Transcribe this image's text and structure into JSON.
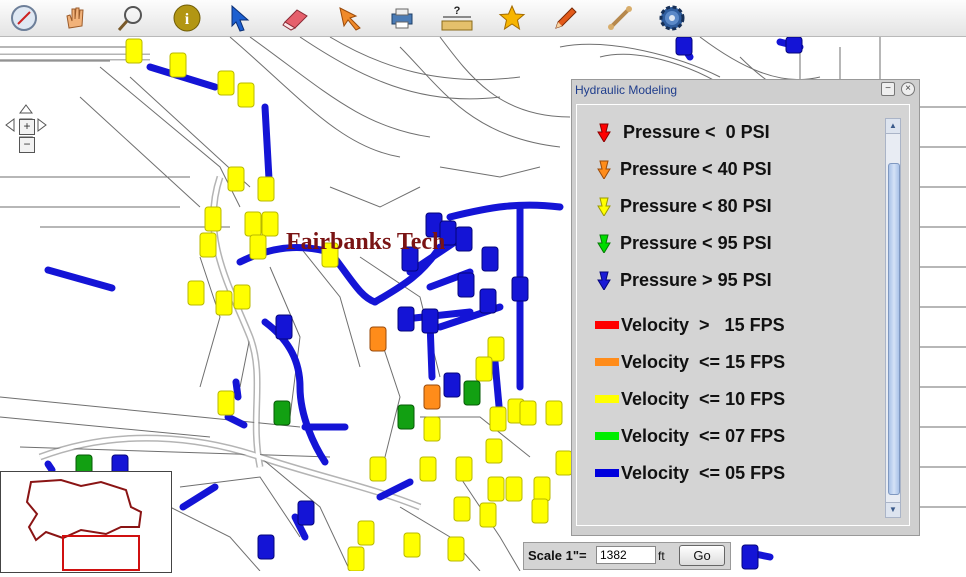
{
  "toolbar": {
    "tools": [
      {
        "name": "compass-icon"
      },
      {
        "name": "hand-pan-icon"
      },
      {
        "name": "magnifier-icon"
      },
      {
        "name": "info-icon"
      },
      {
        "name": "pointer-icon"
      },
      {
        "name": "eraser-icon"
      },
      {
        "name": "select-arrow-icon"
      },
      {
        "name": "printer-icon"
      },
      {
        "name": "measure-ruler-icon",
        "label": "?"
      },
      {
        "name": "star-icon"
      },
      {
        "name": "pencil-icon"
      },
      {
        "name": "bone-tool-icon"
      },
      {
        "name": "gear-icon"
      }
    ]
  },
  "map": {
    "place_label": "Fairbanks Tech"
  },
  "navigation": {
    "zoom_in": "+",
    "zoom_out": "−"
  },
  "panel": {
    "title": "Hydraulic Modeling",
    "minimize": "−",
    "close": "×",
    "pressure_legend": [
      {
        "label": "Pressure <  0 PSI",
        "color": "#ff0000"
      },
      {
        "label": "Pressure < 40 PSI",
        "color": "#ff8c1a"
      },
      {
        "label": "Pressure < 80 PSI",
        "color": "#ffff00"
      },
      {
        "label": "Pressure < 95 PSI",
        "color": "#00dd00"
      },
      {
        "label": "Pressure > 95 PSI",
        "color": "#1a1ad6"
      }
    ],
    "velocity_legend": [
      {
        "label": "Velocity  >   15 FPS",
        "color": "#ff0000"
      },
      {
        "label": "Velocity  <= 15 FPS",
        "color": "#ff8c1a"
      },
      {
        "label": "Velocity  <= 10 FPS",
        "color": "#ffff00"
      },
      {
        "label": "Velocity  <= 07 FPS",
        "color": "#00ee00"
      },
      {
        "label": "Velocity  <= 05 FPS",
        "color": "#0000dd"
      }
    ]
  },
  "scale": {
    "label": "Scale 1\"=",
    "value": "1382",
    "unit": "ft",
    "go_button": "Go"
  }
}
